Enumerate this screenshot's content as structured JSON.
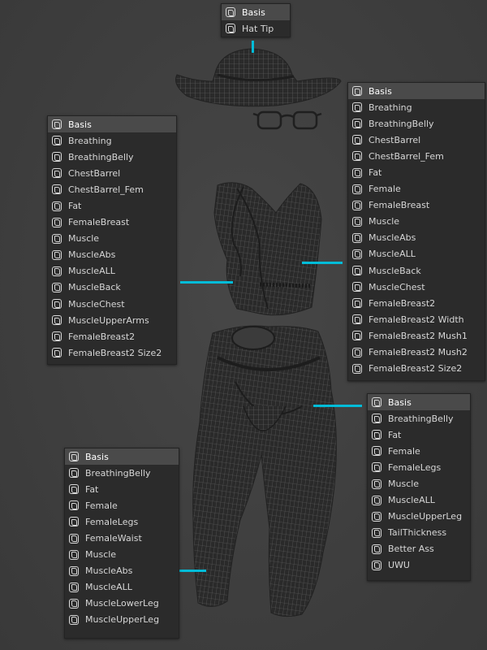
{
  "hat_panel": {
    "items": [
      "Basis",
      "Hat Tip"
    ],
    "selected": 0
  },
  "vest_panel": {
    "items": [
      "Basis",
      "Breathing",
      "BreathingBelly",
      "ChestBarrel",
      "ChestBarrel_Fem",
      "Fat",
      "FemaleBreast",
      "Muscle",
      "MuscleAbs",
      "MuscleALL",
      "MuscleBack",
      "MuscleChest",
      "MuscleUpperArms",
      "FemaleBreast2",
      "FemaleBreast2 Size2"
    ],
    "selected": 0
  },
  "top_panel": {
    "items": [
      "Basis",
      "Breathing",
      "BreathingBelly",
      "ChestBarrel",
      "ChestBarrel_Fem",
      "Fat",
      "Female",
      "FemaleBreast",
      "Muscle",
      "MuscleAbs",
      "MuscleALL",
      "MuscleBack",
      "MuscleChest",
      "FemaleBreast2",
      "FemaleBreast2 Width",
      "FemaleBreast2 Mush1",
      "FemaleBreast2 Mush2",
      "FemaleBreast2 Size2"
    ],
    "selected": 0
  },
  "shorts_panel": {
    "items": [
      "Basis",
      "BreathingBelly",
      "Fat",
      "Female",
      "FemaleLegs",
      "Muscle",
      "MuscleALL",
      "MuscleUpperLeg",
      "TailThickness",
      "Better Ass",
      "UWU"
    ],
    "selected": 0
  },
  "chaps_panel": {
    "items": [
      "Basis",
      "BreathingBelly",
      "Fat",
      "Female",
      "FemaleLegs",
      "FemaleWaist",
      "Muscle",
      "MuscleAbs",
      "MuscleALL",
      "MuscleLowerLeg",
      "MuscleUpperLeg"
    ],
    "selected": 0
  },
  "colors": {
    "leader": "#00bcd8",
    "panel": "#2b2b2b",
    "selected_row": "#4a4a4a",
    "mesh": "#2e2e2e"
  }
}
